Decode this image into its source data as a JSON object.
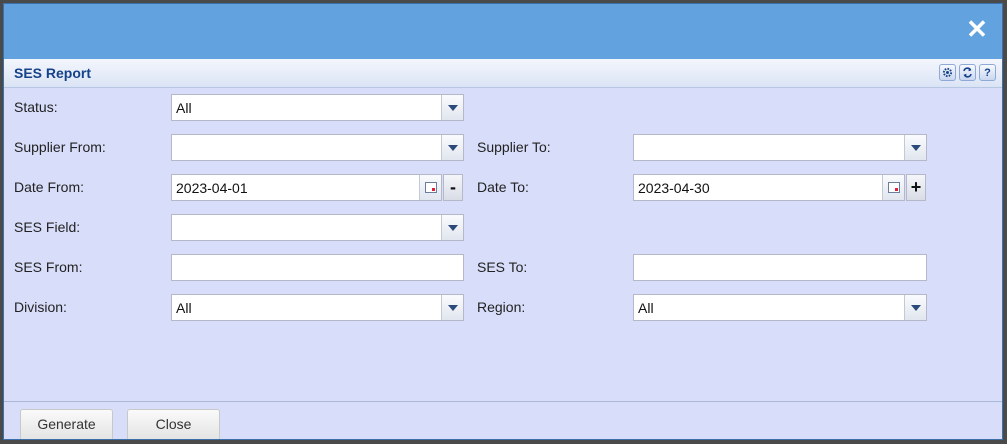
{
  "window": {
    "close_icon": "close-icon"
  },
  "panel": {
    "title": "SES Report",
    "tools": [
      "gear-icon",
      "refresh-icon",
      "help-icon"
    ],
    "help_glyph": "?"
  },
  "form": {
    "status": {
      "label": "Status:",
      "value": "All"
    },
    "supplier_from": {
      "label": "Supplier From:",
      "value": ""
    },
    "supplier_to": {
      "label": "Supplier To:",
      "value": ""
    },
    "date_from": {
      "label": "Date From:",
      "value": "2023-04-01",
      "side_button": "-"
    },
    "date_to": {
      "label": "Date To:",
      "value": "2023-04-30",
      "side_button": "+"
    },
    "ses_field": {
      "label": "SES Field:",
      "value": ""
    },
    "ses_from": {
      "label": "SES From:",
      "value": ""
    },
    "ses_to": {
      "label": "SES To:",
      "value": ""
    },
    "division": {
      "label": "Division:",
      "value": "All"
    },
    "region": {
      "label": "Region:",
      "value": "All"
    }
  },
  "footer": {
    "generate_label": "Generate",
    "close_label": "Close"
  }
}
